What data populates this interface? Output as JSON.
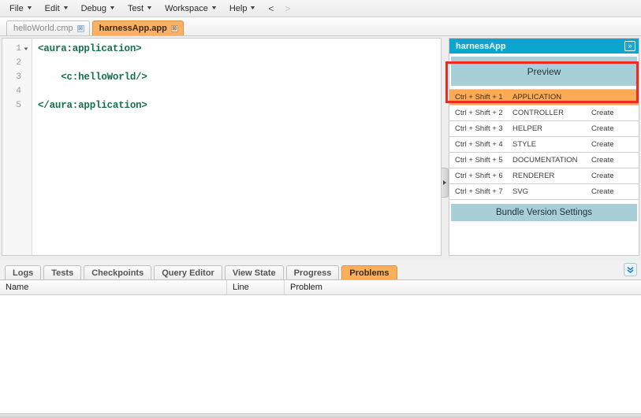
{
  "colors": {
    "accent_orange": "#fbaf5d",
    "header_teal": "#0ca5cd",
    "panel_teal": "#a8cfd8",
    "annotation_red": "#ee2a22",
    "code_green": "#14714a"
  },
  "menubar": {
    "items": [
      {
        "label": "File",
        "caret": "caret-down-icon"
      },
      {
        "label": "Edit",
        "caret": "caret-down-icon"
      },
      {
        "label": "Debug",
        "caret": "caret-down-icon"
      },
      {
        "label": "Test",
        "caret": "caret-down-icon"
      },
      {
        "label": "Workspace",
        "caret": "caret-down-icon"
      },
      {
        "label": "Help",
        "caret": "caret-down-icon"
      }
    ],
    "nav_back": "<",
    "nav_forward": ">"
  },
  "file_tabs": [
    {
      "label": "helloWorld.cmp",
      "close": "⊠",
      "active": false
    },
    {
      "label": "harnessApp.app",
      "close": "⊠",
      "active": true
    }
  ],
  "editor": {
    "lines": [
      {
        "num": "1",
        "fold": "▾",
        "text": "<aura:application>"
      },
      {
        "num": "2",
        "fold": "",
        "text": ""
      },
      {
        "num": "3",
        "fold": "",
        "text": "    <c:helloWorld/>"
      },
      {
        "num": "4",
        "fold": "",
        "text": ""
      },
      {
        "num": "5",
        "fold": "",
        "text": "</aura:application>"
      }
    ]
  },
  "sidebar": {
    "title": "harnessApp",
    "expand_icon": "»",
    "preview_label": "Preview",
    "rows": [
      {
        "shortcut": "Ctrl + Shift + 1",
        "name": "APPLICATION",
        "create": "",
        "active": true
      },
      {
        "shortcut": "Ctrl + Shift + 2",
        "name": "CONTROLLER",
        "create": "Create",
        "active": false
      },
      {
        "shortcut": "Ctrl + Shift + 3",
        "name": "HELPER",
        "create": "Create",
        "active": false
      },
      {
        "shortcut": "Ctrl + Shift + 4",
        "name": "STYLE",
        "create": "Create",
        "active": false
      },
      {
        "shortcut": "Ctrl + Shift + 5",
        "name": "DOCUMENTATION",
        "create": "Create",
        "active": false
      },
      {
        "shortcut": "Ctrl + Shift + 6",
        "name": "RENDERER",
        "create": "Create",
        "active": false
      },
      {
        "shortcut": "Ctrl + Shift + 7",
        "name": "SVG",
        "create": "Create",
        "active": false
      }
    ],
    "bundle_label": "Bundle Version Settings"
  },
  "bottom_panel": {
    "tabs": [
      {
        "label": "Logs",
        "active": false
      },
      {
        "label": "Tests",
        "active": false
      },
      {
        "label": "Checkpoints",
        "active": false
      },
      {
        "label": "Query Editor",
        "active": false
      },
      {
        "label": "View State",
        "active": false
      },
      {
        "label": "Progress",
        "active": false
      },
      {
        "label": "Problems",
        "active": true
      }
    ],
    "collapse_icon": "chevron-double-down-icon",
    "columns": [
      "Name",
      "Line",
      "Problem"
    ],
    "rows": []
  }
}
